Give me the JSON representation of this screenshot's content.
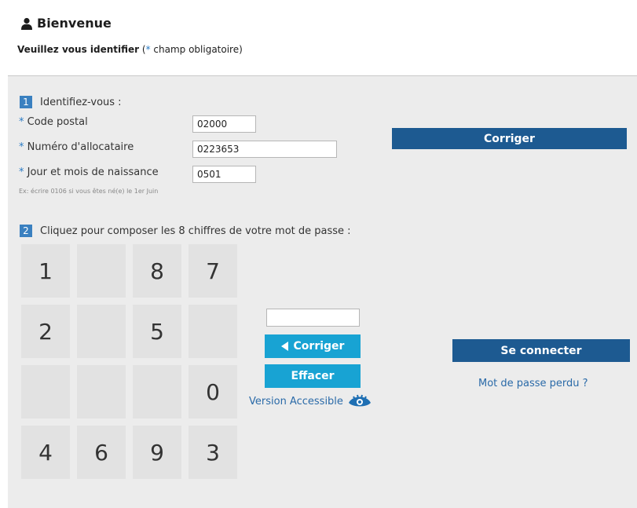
{
  "header": {
    "title": "Bienvenue",
    "subtitle_bold": "Veuillez vous identifier",
    "subtitle_open": " (",
    "subtitle_star": "*",
    "subtitle_rest": " champ obligatoire)"
  },
  "step1": {
    "number": "1",
    "label": "Identifiez-vous :",
    "fields": [
      {
        "star": "*",
        "label": "Code postal",
        "value": "02000"
      },
      {
        "star": "*",
        "label": "Numéro d'allocataire",
        "value": "0223653"
      },
      {
        "star": "*",
        "label": "Jour et mois de naissance",
        "value": "0501"
      }
    ],
    "hint": "Ex: écrire 0106 si vous êtes né(e) le 1er Juin",
    "correct_button": "Corriger"
  },
  "step2": {
    "number": "2",
    "label": "Cliquez pour composer les 8 chiffres de votre mot de passe :",
    "keypad": [
      "1",
      "",
      "8",
      "7",
      "2",
      "",
      "5",
      "",
      "",
      "",
      "",
      "0",
      "4",
      "6",
      "9",
      "3"
    ],
    "password_value": "",
    "correct_button": "Corriger",
    "clear_button": "Effacer",
    "accessible_link": "Version Accessible",
    "connect_button": "Se connecter",
    "lost_password_link": "Mot de passe perdu ?"
  },
  "colors": {
    "dark_button": "#1d5a91",
    "cyan_button": "#18a3d3",
    "accent": "#2a7bc4",
    "panel": "#ececec"
  }
}
